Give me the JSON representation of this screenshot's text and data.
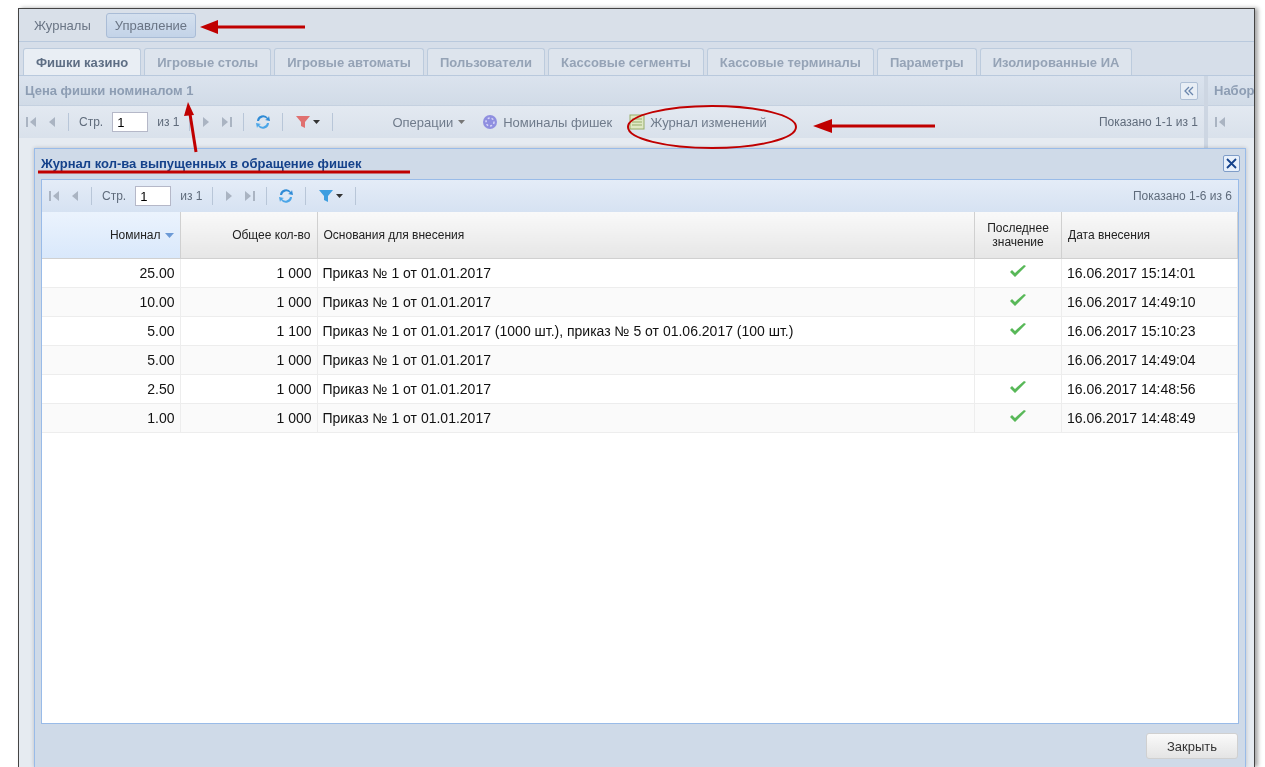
{
  "menu": [
    {
      "label": "Журналы",
      "selected": false
    },
    {
      "label": "Управление",
      "selected": true
    }
  ],
  "tabs": [
    {
      "label": "Фишки казино",
      "selected": true
    },
    {
      "label": "Игровые столы",
      "selected": false
    },
    {
      "label": "Игровые автоматы",
      "selected": false
    },
    {
      "label": "Пользователи",
      "selected": false
    },
    {
      "label": "Кассовые сегменты",
      "selected": false
    },
    {
      "label": "Кассовые терминалы",
      "selected": false
    },
    {
      "label": "Параметры",
      "selected": false
    },
    {
      "label": "Изолированные ИА",
      "selected": false
    }
  ],
  "panel": {
    "title": "Цена фишки номиналом 1",
    "side_panel_title": "Набор",
    "toolbar": {
      "page_label": "Стр.",
      "page": "1",
      "page_total": "из 1",
      "operations": "Операции",
      "chip_denominations": "Номиналы фишек",
      "change_log": "Журнал изменений",
      "display_info": "Показано 1-1 из 1"
    }
  },
  "dialog": {
    "title": "Журнал кол-ва выпущенных в обращение фишек",
    "toolbar": {
      "page_label": "Стр.",
      "page": "1",
      "page_total": "из 1",
      "display_info": "Показано 1-6 из 6"
    },
    "columns": [
      {
        "label": "Номинал",
        "sorted": true
      },
      {
        "label": "Общее кол-во",
        "sorted": false
      },
      {
        "label": "Основания для внесения",
        "sorted": false
      },
      {
        "label": "Последнее значение",
        "sorted": false
      },
      {
        "label": "Дата внесения",
        "sorted": false
      }
    ],
    "rows": [
      {
        "nominal": "25.00",
        "total": "1 000",
        "basis": "Приказ № 1 от 01.01.2017",
        "latest": true,
        "date": "16.06.2017 15:14:01"
      },
      {
        "nominal": "10.00",
        "total": "1 000",
        "basis": "Приказ № 1 от 01.01.2017",
        "latest": true,
        "date": "16.06.2017 14:49:10"
      },
      {
        "nominal": "5.00",
        "total": "1 100",
        "basis": "Приказ № 1 от 01.01.2017 (1000 шт.), приказ № 5 от 01.06.2017 (100 шт.)",
        "latest": true,
        "date": "16.06.2017 15:10:23"
      },
      {
        "nominal": "5.00",
        "total": "1 000",
        "basis": "Приказ № 1 от 01.01.2017",
        "latest": false,
        "date": "16.06.2017 14:49:04"
      },
      {
        "nominal": "2.50",
        "total": "1 000",
        "basis": "Приказ № 1 от 01.01.2017",
        "latest": true,
        "date": "16.06.2017 14:48:56"
      },
      {
        "nominal": "1.00",
        "total": "1 000",
        "basis": "Приказ № 1 от 01.01.2017",
        "latest": true,
        "date": "16.06.2017 14:48:49"
      }
    ],
    "close_button": "Закрыть"
  }
}
